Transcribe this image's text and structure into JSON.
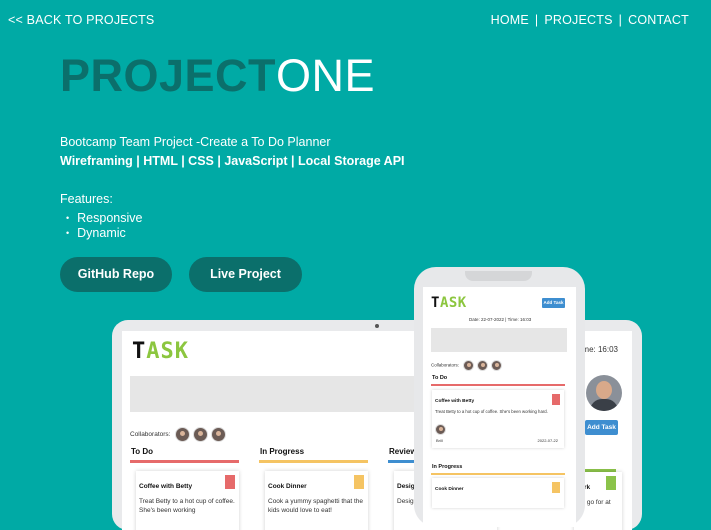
{
  "nav": {
    "back": "<< BACK TO PROJECTS",
    "links": [
      "HOME",
      "PROJECTS",
      "CONTACT"
    ],
    "separator": "|"
  },
  "hero": {
    "title_bold": "PROJECT",
    "title_light": "ONE",
    "subtitle": "Bootcamp Team Project -Create a To Do Planner",
    "tech": "Wireframing | HTML | CSS | JavaScript | Local Storage API",
    "features_label": "Features:",
    "features": [
      "Responsive",
      "Dynamic"
    ],
    "buttons": {
      "github": "GitHub Repo",
      "live": "Live Project"
    }
  },
  "colors": {
    "background": "#00aaa5",
    "accent_dark": "#0b6f6b",
    "todo_red": "#e66a6a",
    "progress_yellow": "#f5c463",
    "review_blue": "#3e8ed0",
    "done_green": "#8bc34a"
  },
  "tablet": {
    "logo_t": "T",
    "logo_ask": "ASK",
    "date_time": "| Time: 16:03",
    "collaborators": "Collaborators:",
    "add_task": "Add Task",
    "columns": [
      {
        "head": "To Do",
        "card_title": "Coffee with Betty",
        "card_desc": "Treat Betty to a hot cup of coffee. She's been working"
      },
      {
        "head": "In Progress",
        "card_title": "Cook Dinner",
        "card_desc": "Cook a yummy spaghetti that the kids would love to eat!"
      },
      {
        "head": "Review",
        "card_title": "Design",
        "card_desc": "Design the Ta"
      }
    ],
    "right_card_title": "Park",
    "right_card_desc": "up, go for at"
  },
  "phone": {
    "logo_t": "T",
    "logo_ask": "ASK",
    "add_task": "Add Task",
    "date": "Date: 22-07-2022 | Time: 16:03",
    "collaborators": "Collaborators:",
    "todo_head": "To Do",
    "todo_card_title": "Coffee with Betty",
    "todo_card_desc": "Treat Betty to a hot cup of coffee. She's been working hard.",
    "todo_card_who": "Brill",
    "todo_card_due": "2022-07-22",
    "progress_head": "In Progress",
    "progress_card_title": "Cook Dinner"
  }
}
